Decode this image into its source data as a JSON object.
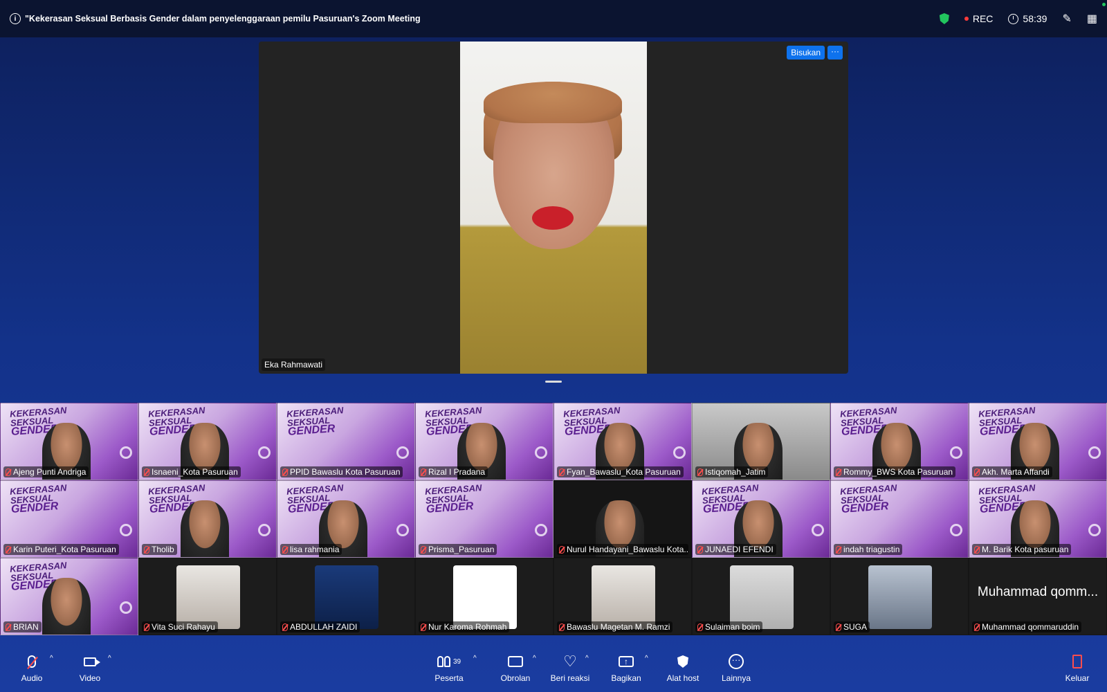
{
  "meeting": {
    "title": "\"Kekerasan Seksual Berbasis Gender dalam penyelenggaraan pemilu Pasuruan's Zoom Meeting",
    "rec_label": "REC",
    "timer": "58:39"
  },
  "speaker": {
    "name": "Eka Rahmawati",
    "whisper_label": "Bisukan",
    "more_label": "···"
  },
  "poster": {
    "line1": "KEKERASAN",
    "line2": "SEKSUAL",
    "line3": "GENDER"
  },
  "participants": [
    {
      "name": "Ajeng Punti Andriga",
      "kind": "poster"
    },
    {
      "name": "Isnaeni_Kota Pasuruan",
      "kind": "poster"
    },
    {
      "name": "PPID Bawaslu Kota Pasuruan",
      "kind": "poster"
    },
    {
      "name": "Rizal I Pradana",
      "kind": "poster"
    },
    {
      "name": "Fyan_Bawaslu_Kota Pasuruan",
      "kind": "poster"
    },
    {
      "name": "Istiqomah_Jatim",
      "kind": "camera"
    },
    {
      "name": "Rommy_BWS Kota Pasuruan",
      "kind": "poster"
    },
    {
      "name": "Akh. Marta Affandi",
      "kind": "poster"
    },
    {
      "name": "Karin Puteri_Kota Pasuruan",
      "kind": "poster"
    },
    {
      "name": "Tholib",
      "kind": "poster"
    },
    {
      "name": "lisa rahmania",
      "kind": "poster"
    },
    {
      "name": "Prisma_Pasuruan",
      "kind": "poster"
    },
    {
      "name": "Nurul Handayani_Bawaslu Kota...",
      "kind": "dark-camera"
    },
    {
      "name": "JUNAEDI EFENDI",
      "kind": "poster"
    },
    {
      "name": "indah triagustin",
      "kind": "poster"
    },
    {
      "name": "M. Barik Kota pasuruan",
      "kind": "poster"
    },
    {
      "name": "BRIAN",
      "kind": "poster"
    },
    {
      "name": "Vita Suci Rahayu",
      "kind": "thumb"
    },
    {
      "name": "ABDULLAH ZAIDI",
      "kind": "thumb-blue"
    },
    {
      "name": "Nur Karoma Rohmah",
      "kind": "thumb-table"
    },
    {
      "name": "Bawaslu Magetan M. Ramzi",
      "kind": "thumb"
    },
    {
      "name": "Sulaiman boim",
      "kind": "thumb-room"
    },
    {
      "name": "SUGA",
      "kind": "thumb-radio"
    },
    {
      "name": "Muhammad qommaruddin",
      "kind": "name-only",
      "big": "Muhammad qomm..."
    }
  ],
  "toolbar": {
    "audio": "Audio",
    "video": "Video",
    "participants": "Peserta",
    "participants_count": "39",
    "chat": "Obrolan",
    "react": "Beri reaksi",
    "share": "Bagikan",
    "host_tools": "Alat host",
    "more": "Lainnya",
    "leave": "Keluar",
    "caret": "^"
  }
}
